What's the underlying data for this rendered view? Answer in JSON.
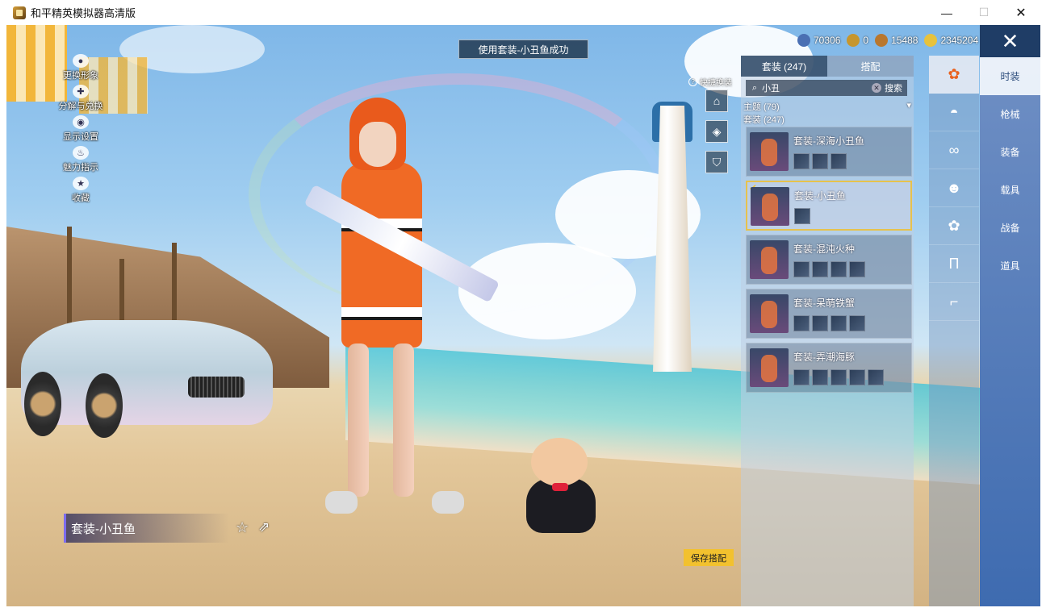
{
  "window": {
    "title": "和平精英模拟器高清版",
    "minimize": "—",
    "maximize": "☐",
    "close": "✕"
  },
  "toast": "使用套装-小丑鱼成功",
  "left_menu": [
    {
      "label": "更换形象",
      "icon": "person-icon"
    },
    {
      "label": "分解与兑换",
      "icon": "decompose-icon"
    },
    {
      "label": "显示设置",
      "icon": "eye-icon"
    },
    {
      "label": "魅力指示",
      "icon": "flame-icon"
    },
    {
      "label": "收藏",
      "icon": "badge-icon"
    }
  ],
  "currency": [
    {
      "value": "70306",
      "icon": "coin-blue-icon",
      "color": "#4a6fb3"
    },
    {
      "value": "0",
      "icon": "coin-gold-icon",
      "color": "#c7962d"
    },
    {
      "value": "15488",
      "icon": "coin-bronze-icon",
      "color": "#b9772e"
    },
    {
      "value": "2345204",
      "icon": "coin-yellow-icon",
      "color": "#e7c23d"
    }
  ],
  "quick_swap": {
    "label": "快捷换装",
    "help": "?"
  },
  "panel": {
    "tabs": [
      "套装 (247)",
      "搭配"
    ],
    "search_value": "小丑",
    "search_button": "搜索",
    "filter_theme": "主题 (79)",
    "filter_suits": "套装 (247)",
    "suits": [
      {
        "name": "套装-深海小丑鱼",
        "items": 3,
        "selected": false
      },
      {
        "name": "套装-小丑鱼",
        "items": 1,
        "selected": true
      },
      {
        "name": "套装-混沌火种",
        "items": 4,
        "selected": false
      },
      {
        "name": "套装-呆萌铁蟹",
        "items": 4,
        "selected": false
      },
      {
        "name": "套装-弄潮海豚",
        "items": 5,
        "selected": false
      }
    ]
  },
  "categories": [
    {
      "label": "时装",
      "icon": "outfit-icon",
      "active": true
    },
    {
      "label": "枪械",
      "icon": "cap-icon",
      "active": false
    },
    {
      "label": "装备",
      "icon": "goggles-icon",
      "active": false
    },
    {
      "label": "载具",
      "icon": "face-icon",
      "active": false
    },
    {
      "label": "战备",
      "icon": "top-icon",
      "active": false
    },
    {
      "label": "道具",
      "icon": "pants-icon",
      "active": false
    },
    {
      "label": "",
      "icon": "shoes-icon",
      "active": false
    }
  ],
  "name_plate": "套装-小丑鱼",
  "save_button": "保存搭配",
  "close_icon": "✕",
  "accent": "#f2c12e"
}
